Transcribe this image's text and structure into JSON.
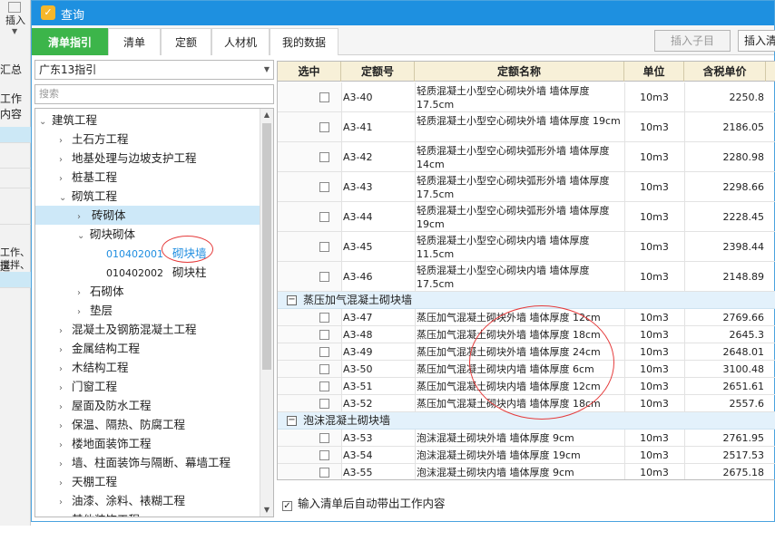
{
  "bg": {
    "insert_label": "插入",
    "summary_tab": "汇总",
    "work_col": "工作内容",
    "text_a": "工作、运",
    "text_b": "搅拌、刹"
  },
  "window": {
    "title": "查询"
  },
  "tabs": [
    "清单指引",
    "清单",
    "定额",
    "人材机",
    "我的数据"
  ],
  "toolbar": {
    "insert_child": "插入子目",
    "insert_list": "插入清单"
  },
  "left": {
    "combo_value": "广东13指引",
    "search_placeholder": "搜索",
    "tree": [
      {
        "label": "建筑工程",
        "level": 0,
        "arrow": "down"
      },
      {
        "label": "土石方工程",
        "level": 1,
        "arrow": "right"
      },
      {
        "label": "地基处理与边坡支护工程",
        "level": 1,
        "arrow": "right"
      },
      {
        "label": "桩基工程",
        "level": 1,
        "arrow": "right"
      },
      {
        "label": "砌筑工程",
        "level": 1,
        "arrow": "down"
      },
      {
        "label": "砖砌体",
        "level": 2,
        "arrow": "right",
        "selected": true
      },
      {
        "label": "砌块砌体",
        "level": 2,
        "arrow": "down"
      },
      {
        "code": "010402001",
        "label": "砌块墙",
        "level": 3,
        "highlight": true
      },
      {
        "code": "010402002",
        "label": "砌块柱",
        "level": 3
      },
      {
        "label": "石砌体",
        "level": 2,
        "arrow": "right"
      },
      {
        "label": "垫层",
        "level": 2,
        "arrow": "right"
      },
      {
        "label": "混凝土及钢筋混凝土工程",
        "level": 1,
        "arrow": "right"
      },
      {
        "label": "金属结构工程",
        "level": 1,
        "arrow": "right"
      },
      {
        "label": "木结构工程",
        "level": 1,
        "arrow": "right"
      },
      {
        "label": "门窗工程",
        "level": 1,
        "arrow": "right"
      },
      {
        "label": "屋面及防水工程",
        "level": 1,
        "arrow": "right"
      },
      {
        "label": "保温、隔热、防腐工程",
        "level": 1,
        "arrow": "right"
      },
      {
        "label": "楼地面装饰工程",
        "level": 1,
        "arrow": "right"
      },
      {
        "label": "墙、柱面装饰与隔断、幕墙工程",
        "level": 1,
        "arrow": "right"
      },
      {
        "label": "天棚工程",
        "level": 1,
        "arrow": "right"
      },
      {
        "label": "油漆、涂料、裱糊工程",
        "level": 1,
        "arrow": "right"
      },
      {
        "label": "其他装饰工程",
        "level": 1,
        "arrow": "right"
      }
    ]
  },
  "table": {
    "headers": [
      "选中",
      "定额号",
      "定额名称",
      "单位",
      "含税单价"
    ],
    "rows": [
      {
        "type": "item",
        "code": "A3-40",
        "name": "轻质混凝土小型空心砌块外墙 墙体厚度 17.5cm",
        "unit": "10m3",
        "price": "2250.8"
      },
      {
        "type": "item",
        "code": "A3-41",
        "name": "轻质混凝土小型空心砌块外墙 墙体厚度 19cm",
        "unit": "10m3",
        "price": "2186.05"
      },
      {
        "type": "item",
        "code": "A3-42",
        "name": "轻质混凝土小型空心砌块弧形外墙 墙体厚度 14cm",
        "unit": "10m3",
        "price": "2280.98"
      },
      {
        "type": "item",
        "code": "A3-43",
        "name": "轻质混凝土小型空心砌块弧形外墙 墙体厚度 17.5cm",
        "unit": "10m3",
        "price": "2298.66"
      },
      {
        "type": "item",
        "code": "A3-44",
        "name": "轻质混凝土小型空心砌块弧形外墙 墙体厚度 19cm",
        "unit": "10m3",
        "price": "2228.45"
      },
      {
        "type": "item",
        "code": "A3-45",
        "name": "轻质混凝土小型空心砌块内墙 墙体厚度 11.5cm",
        "unit": "10m3",
        "price": "2398.44"
      },
      {
        "type": "item",
        "code": "A3-46",
        "name": "轻质混凝土小型空心砌块内墙 墙体厚度 17.5cm",
        "unit": "10m3",
        "price": "2148.89"
      },
      {
        "type": "group",
        "name": "蒸压加气混凝土砌块墙"
      },
      {
        "type": "item",
        "code": "A3-47",
        "name": "蒸压加气混凝土砌块外墙 墙体厚度 12cm",
        "unit": "10m3",
        "price": "2769.66"
      },
      {
        "type": "item",
        "code": "A3-48",
        "name": "蒸压加气混凝土砌块外墙 墙体厚度 18cm",
        "unit": "10m3",
        "price": "2645.3"
      },
      {
        "type": "item",
        "code": "A3-49",
        "name": "蒸压加气混凝土砌块外墙 墙体厚度 24cm",
        "unit": "10m3",
        "price": "2648.01"
      },
      {
        "type": "item",
        "code": "A3-50",
        "name": "蒸压加气混凝土砌块内墙 墙体厚度 6cm",
        "unit": "10m3",
        "price": "3100.48"
      },
      {
        "type": "item",
        "code": "A3-51",
        "name": "蒸压加气混凝土砌块内墙 墙体厚度 12cm",
        "unit": "10m3",
        "price": "2651.61"
      },
      {
        "type": "item",
        "code": "A3-52",
        "name": "蒸压加气混凝土砌块内墙 墙体厚度 18cm",
        "unit": "10m3",
        "price": "2557.6"
      },
      {
        "type": "group",
        "name": "泡沫混凝土砌块墙"
      },
      {
        "type": "item",
        "code": "A3-53",
        "name": "泡沫混凝土砌块外墙 墙体厚度 9cm",
        "unit": "10m3",
        "price": "2761.95"
      },
      {
        "type": "item",
        "code": "A3-54",
        "name": "泡沫混凝土砌块外墙 墙体厚度 19cm",
        "unit": "10m3",
        "price": "2517.53"
      },
      {
        "type": "item",
        "code": "A3-55",
        "name": "泡沫混凝土砌块内墙 墙体厚度 9cm",
        "unit": "10m3",
        "price": "2675.18"
      }
    ]
  },
  "footer": {
    "auto_work_content": "输入清单后自动带出工作内容"
  }
}
